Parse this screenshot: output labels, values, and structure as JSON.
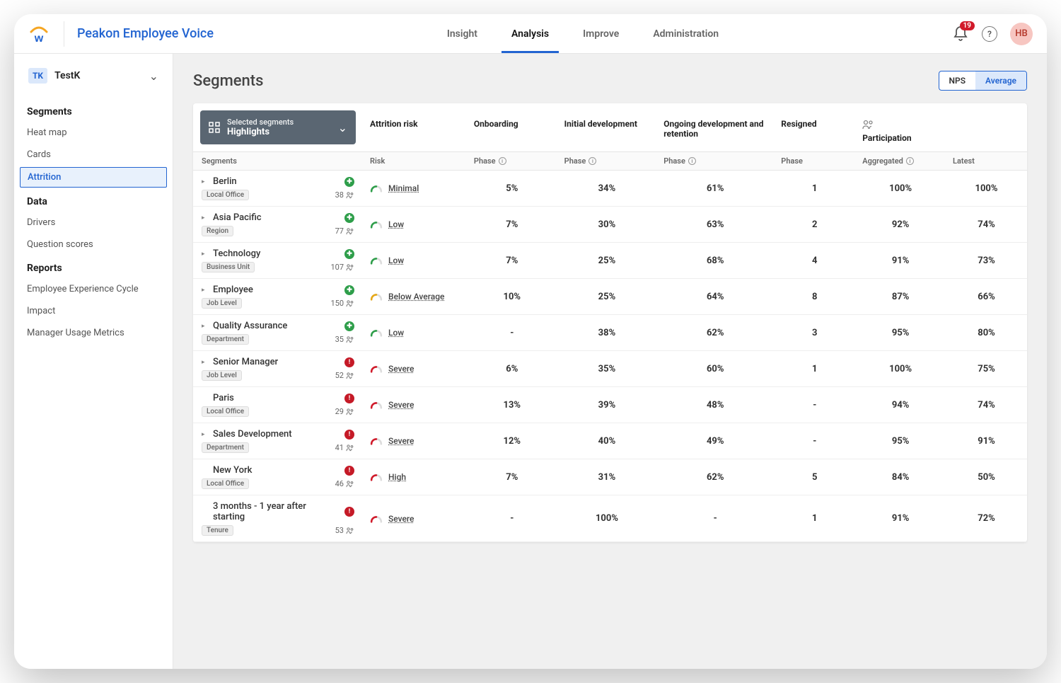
{
  "app_title": "Peakon Employee Voice",
  "notifications": {
    "count": "19"
  },
  "avatar": "HB",
  "topnav": {
    "items": [
      "Insight",
      "Analysis",
      "Improve",
      "Administration"
    ],
    "active_index": 1
  },
  "workspace": {
    "chip": "TK",
    "name": "TestK"
  },
  "sidebar": {
    "sections": [
      {
        "title": "Segments",
        "items": [
          "Heat map",
          "Cards",
          "Attrition"
        ],
        "selected_index": 2
      },
      {
        "title": "Data",
        "items": [
          "Drivers",
          "Question scores"
        ]
      },
      {
        "title": "Reports",
        "items": [
          "Employee Experience Cycle",
          "Impact",
          "Manager Usage Metrics"
        ]
      }
    ]
  },
  "page": {
    "title": "Segments",
    "toggle": {
      "options": [
        "NPS",
        "Average"
      ],
      "active_index": 1
    },
    "segment_selector": {
      "label": "Selected segments",
      "value": "Highlights"
    },
    "columns": [
      {
        "title": "Attrition risk",
        "sub": "Risk"
      },
      {
        "title": "Onboarding",
        "sub": "Phase",
        "info": true
      },
      {
        "title": "Initial development",
        "sub": "Phase",
        "info": true
      },
      {
        "title": "Ongoing development and retention",
        "sub": "Phase",
        "info": true
      },
      {
        "title": "Resigned",
        "sub": "Phase"
      },
      {
        "title": "Participation",
        "sub": "Aggregated",
        "icon": true,
        "info": true
      },
      {
        "title": "",
        "sub": "Latest"
      }
    ],
    "segments_header": "Segments",
    "rows": [
      {
        "name": "Berlin",
        "tag": "Local Office",
        "count": "38",
        "status": "good",
        "expandable": true,
        "risk": "Minimal",
        "risk_color": "#2e9e4a",
        "onboarding": "5%",
        "initial": "34%",
        "ongoing": "61%",
        "resigned": "1",
        "aggregated": "100%",
        "latest": "100%"
      },
      {
        "name": "Asia Pacific",
        "tag": "Region",
        "count": "77",
        "status": "good",
        "expandable": true,
        "risk": "Low",
        "risk_color": "#2e9e4a",
        "onboarding": "7%",
        "initial": "30%",
        "ongoing": "63%",
        "resigned": "2",
        "aggregated": "92%",
        "latest": "74%"
      },
      {
        "name": "Technology",
        "tag": "Business Unit",
        "count": "107",
        "status": "good",
        "expandable": true,
        "risk": "Low",
        "risk_color": "#2e9e4a",
        "onboarding": "7%",
        "initial": "25%",
        "ongoing": "68%",
        "resigned": "4",
        "aggregated": "91%",
        "latest": "73%"
      },
      {
        "name": "Employee",
        "tag": "Job Level",
        "count": "150",
        "status": "good",
        "expandable": true,
        "risk": "Below Average",
        "risk_color": "#e6a817",
        "onboarding": "10%",
        "initial": "25%",
        "ongoing": "64%",
        "resigned": "8",
        "aggregated": "87%",
        "latest": "66%"
      },
      {
        "name": "Quality Assurance",
        "tag": "Department",
        "count": "35",
        "status": "good",
        "expandable": true,
        "risk": "Low",
        "risk_color": "#2e9e4a",
        "onboarding": "-",
        "initial": "38%",
        "ongoing": "62%",
        "resigned": "3",
        "aggregated": "95%",
        "latest": "80%"
      },
      {
        "name": "Senior Manager",
        "tag": "Job Level",
        "count": "52",
        "status": "bad",
        "expandable": true,
        "risk": "Severe",
        "risk_color": "#d11a2a",
        "onboarding": "6%",
        "initial": "35%",
        "ongoing": "60%",
        "resigned": "1",
        "aggregated": "100%",
        "latest": "75%"
      },
      {
        "name": "Paris",
        "tag": "Local Office",
        "count": "29",
        "status": "bad",
        "expandable": false,
        "risk": "Severe",
        "risk_color": "#d11a2a",
        "onboarding": "13%",
        "initial": "39%",
        "ongoing": "48%",
        "resigned": "-",
        "aggregated": "94%",
        "latest": "74%"
      },
      {
        "name": "Sales Development",
        "tag": "Department",
        "count": "41",
        "status": "bad",
        "expandable": true,
        "risk": "Severe",
        "risk_color": "#d11a2a",
        "onboarding": "12%",
        "initial": "40%",
        "ongoing": "49%",
        "resigned": "-",
        "aggregated": "95%",
        "latest": "91%"
      },
      {
        "name": "New York",
        "tag": "Local Office",
        "count": "46",
        "status": "bad",
        "expandable": false,
        "risk": "High",
        "risk_color": "#d11a2a",
        "onboarding": "7%",
        "initial": "31%",
        "ongoing": "62%",
        "resigned": "5",
        "aggregated": "84%",
        "latest": "50%"
      },
      {
        "name": "3 months - 1 year after starting",
        "tag": "Tenure",
        "count": "53",
        "status": "bad",
        "expandable": false,
        "risk": "Severe",
        "risk_color": "#d11a2a",
        "onboarding": "-",
        "initial": "100%",
        "ongoing": "-",
        "resigned": "1",
        "aggregated": "91%",
        "latest": "72%"
      }
    ]
  }
}
